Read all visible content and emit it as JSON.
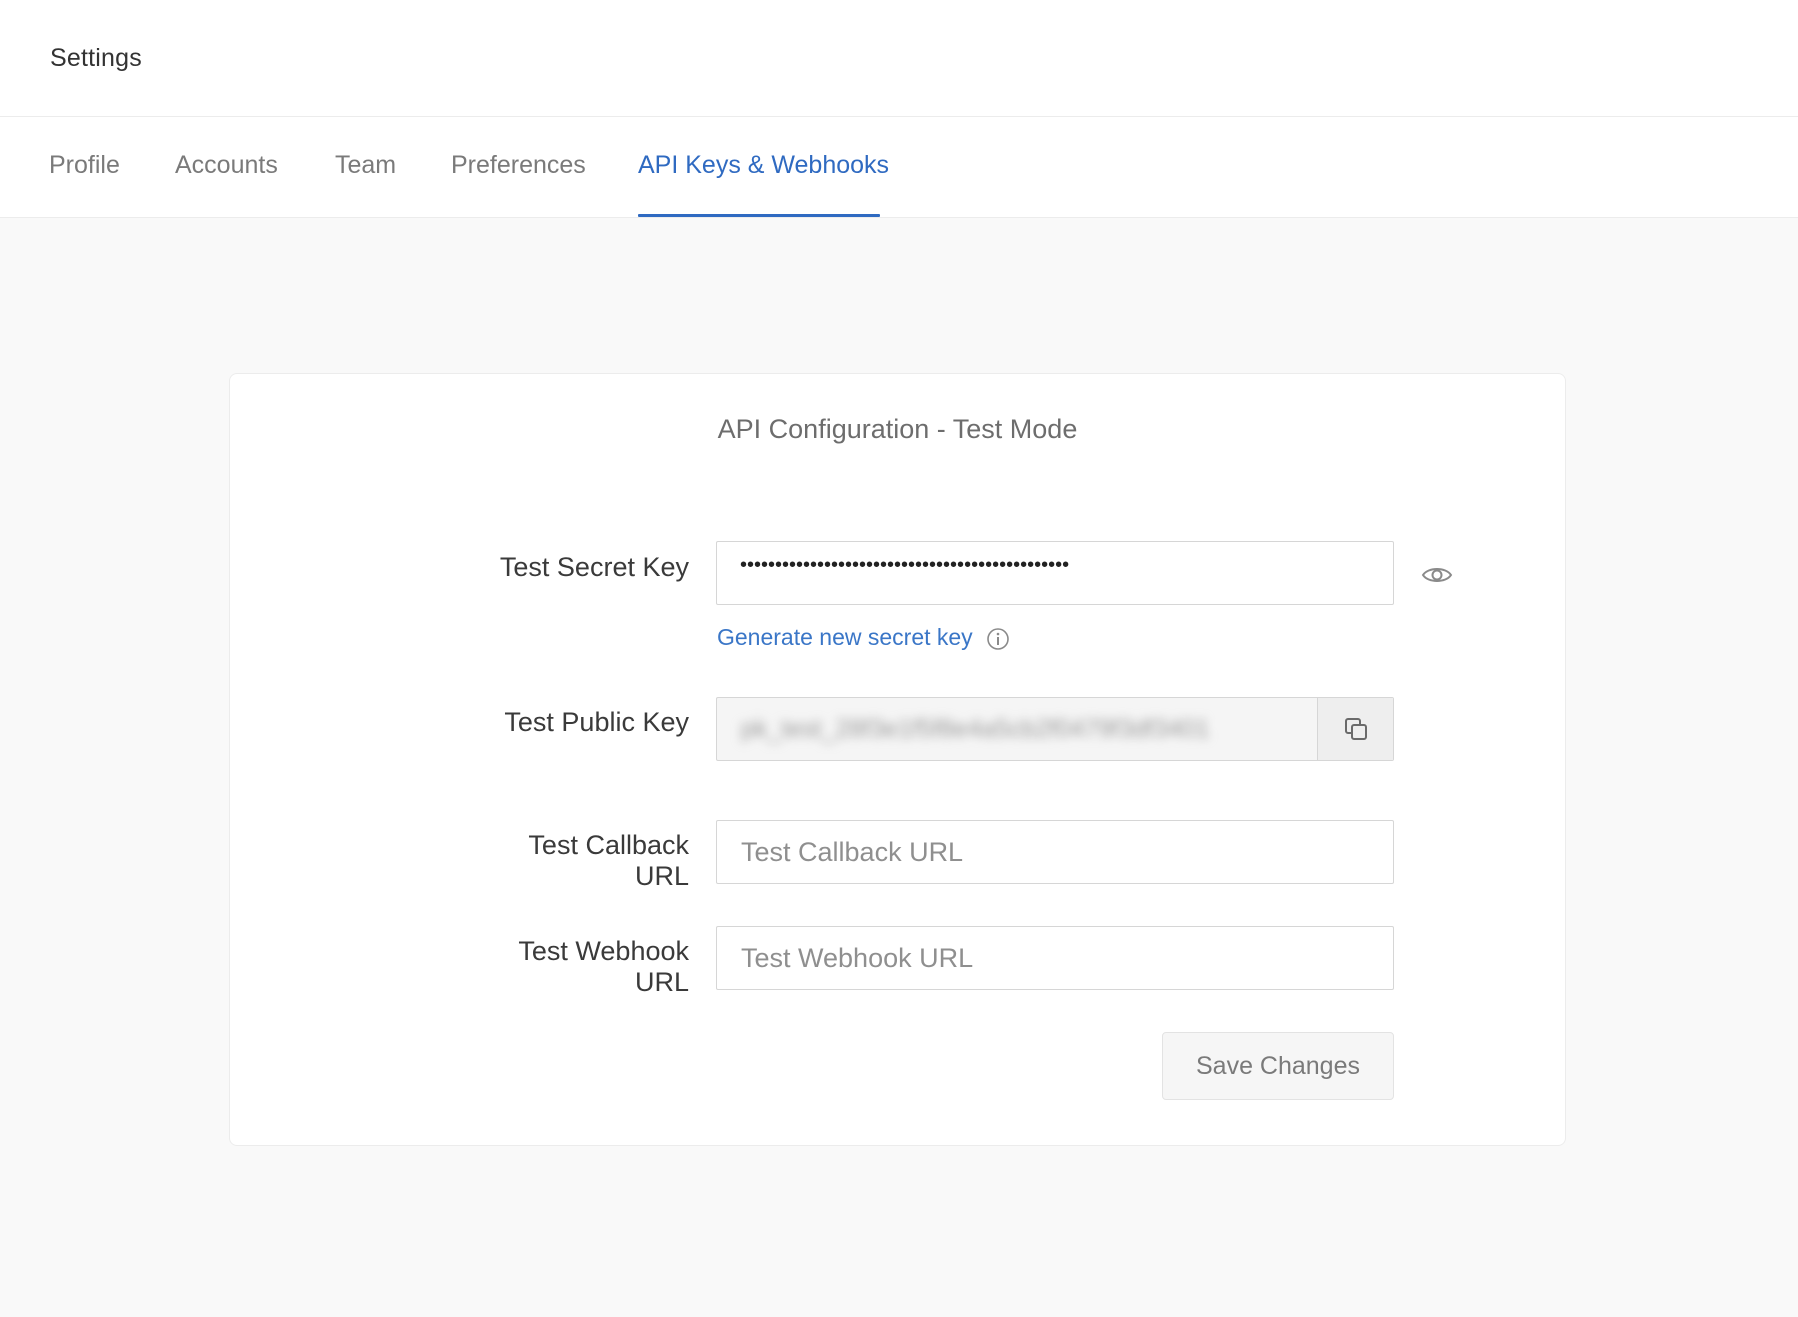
{
  "header": {
    "title": "Settings"
  },
  "tabs": [
    {
      "label": "Profile",
      "active": false
    },
    {
      "label": "Accounts",
      "active": false
    },
    {
      "label": "Team",
      "active": false
    },
    {
      "label": "Preferences",
      "active": false
    },
    {
      "label": "API Keys & Webhooks",
      "active": true
    }
  ],
  "card": {
    "title": "API Configuration - Test Mode",
    "secret_key": {
      "label": "Test Secret Key",
      "masked_value": "•••••••••••••••••••••••••••••••••••••••••••••••",
      "generate_link": "Generate new secret key"
    },
    "public_key": {
      "label": "Test Public Key",
      "value": "pk_test_28f3e1f5f8e4a5cb2f0479f3df3401"
    },
    "callback_url": {
      "label": "Test Callback URL",
      "placeholder": "Test Callback URL",
      "value": ""
    },
    "webhook_url": {
      "label": "Test Webhook URL",
      "placeholder": "Test Webhook URL",
      "value": ""
    },
    "save_label": "Save Changes"
  },
  "colors": {
    "accent": "#2f6ac1",
    "link": "#3a76c7",
    "background": "#f9f9f9"
  },
  "icons": {
    "reveal": "eye-icon",
    "info": "info-icon",
    "copy": "copy-icon"
  }
}
